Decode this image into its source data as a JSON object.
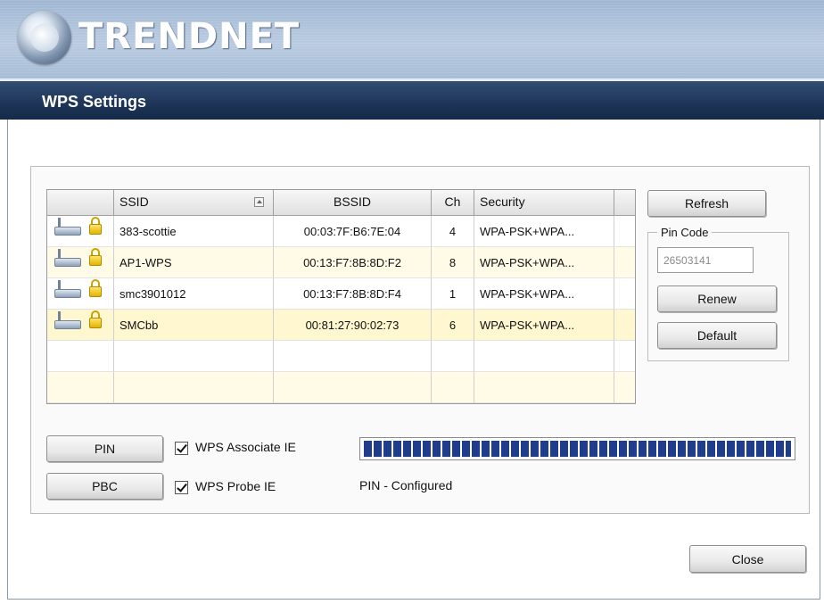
{
  "brand": {
    "name": "TRENDNET",
    "logo_icon": "globe-logo-icon"
  },
  "dialog": {
    "title": "WPS Settings"
  },
  "table": {
    "columns": [
      "",
      "SSID",
      "BSSID",
      "Ch",
      "Security"
    ],
    "rows": [
      {
        "ssid": "383-scottie",
        "bssid": "00:03:7F:B6:7E:04",
        "ch": "4",
        "security": "WPA-PSK+WPA..."
      },
      {
        "ssid": "AP1-WPS",
        "bssid": "00:13:F7:8B:8D:F2",
        "ch": "8",
        "security": "WPA-PSK+WPA..."
      },
      {
        "ssid": "smc3901012",
        "bssid": "00:13:F7:8B:8D:F4",
        "ch": "1",
        "security": "WPA-PSK+WPA..."
      },
      {
        "ssid": "SMCbb",
        "bssid": "00:81:27:90:02:73",
        "ch": "6",
        "security": "WPA-PSK+WPA..."
      }
    ],
    "row_icons": [
      "router-icon",
      "lock-icon"
    ]
  },
  "buttons": {
    "refresh": "Refresh",
    "renew": "Renew",
    "default": "Default",
    "pin": "PIN",
    "pbc": "PBC",
    "close": "Close"
  },
  "pin_code": {
    "label": "Pin Code",
    "value": "26503141"
  },
  "checkboxes": {
    "wps_associate_ie": {
      "label": "WPS Associate IE",
      "checked": true
    },
    "wps_probe_ie": {
      "label": "WPS Probe IE",
      "checked": true
    }
  },
  "status": {
    "text": "PIN - Configured",
    "progress_percent": 100
  },
  "colors": {
    "title_bar": "#1e3558",
    "progress": "#1f3d8c",
    "selected_row": "#fff7cf"
  }
}
